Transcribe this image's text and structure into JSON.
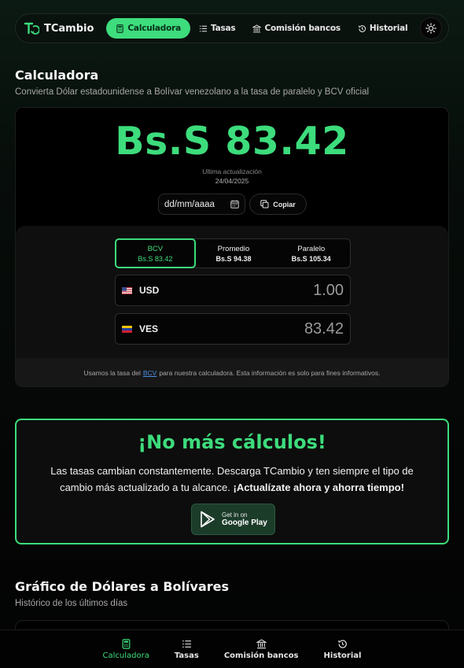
{
  "colors": {
    "accent": "#3ddc7c",
    "background": "#030303",
    "link": "#4d8fe6"
  },
  "nav": {
    "logo_text": "TCambio",
    "items": [
      {
        "label": "Calculadora",
        "icon": "calculator-icon",
        "active": true
      },
      {
        "label": "Tasas",
        "icon": "list-icon"
      },
      {
        "label": "Comisión bancos",
        "icon": "bank-icon"
      },
      {
        "label": "Historial",
        "icon": "history-icon"
      }
    ],
    "theme_icon": "sun-icon"
  },
  "calculator": {
    "title": "Calculadora",
    "subtitle": "Convierta Dólar estadounidense a Bolívar venezolano a la tasa de paralelo y BCV oficial",
    "amount": "Bs.S 83.42",
    "updated_label": "Ultima actualización",
    "updated_date": "24/04/2025",
    "date_placeholder": "dd/mm/aaaa",
    "copy_label": "Copiar",
    "rates": [
      {
        "name": "BCV",
        "value": "Bs.S 83.42",
        "active": true
      },
      {
        "name": "Promedio",
        "value": "Bs.S 94.38"
      },
      {
        "name": "Paralelo",
        "value": "Bs.S 105.34"
      }
    ],
    "from": {
      "code": "USD",
      "value": "1.00"
    },
    "to": {
      "code": "VES",
      "value": "83.42"
    },
    "note_before": "Usamos la tasa del",
    "note_link": "BCV",
    "note_after": "para nuestra calculadora. Esta información es solo para fines informativos."
  },
  "promo": {
    "title": "¡No más cálculos!",
    "text": "Las tasas cambian constantemente. Descarga TCambio y ten siempre el tipo de cambio más actualizado a tu alcance.",
    "text_bold": "¡Actualízate ahora y ahorra tiempo!",
    "play_top": "Get in on",
    "play_main": "Google Play"
  },
  "chart_section": {
    "title": "Gráfico de Dólares a Bolívares",
    "subtitle": "Histórico de los últimos días"
  },
  "bottom_nav": [
    {
      "label": "Calculadora",
      "icon": "calculator-icon",
      "active": true
    },
    {
      "label": "Tasas",
      "icon": "list-icon"
    },
    {
      "label": "Comisión bancos",
      "icon": "bank-icon"
    },
    {
      "label": "Historial",
      "icon": "history-icon"
    }
  ]
}
